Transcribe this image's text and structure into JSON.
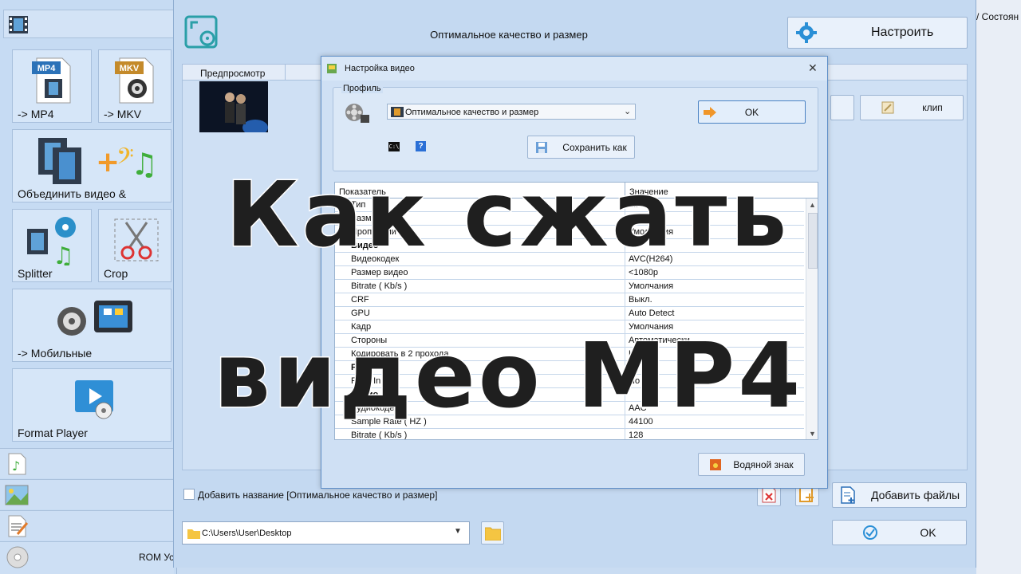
{
  "sidebar": {
    "tiles": [
      {
        "label": "-> MP4",
        "badge": "MP4"
      },
      {
        "label": "-> MKV",
        "badge": "MKV"
      },
      {
        "label": "Объединить видео &"
      },
      {
        "label": "Splitter"
      },
      {
        "label": "Crop"
      },
      {
        "label": "-> Мобильные"
      },
      {
        "label": "Format Player"
      }
    ],
    "bottom_text": "ROM Устройство\\DVD\\CD\\ISO"
  },
  "main": {
    "header_title": "Оптимальное качество и размер",
    "configure_label": "Настроить",
    "preview_header": "Предпросмотр",
    "clip_label": "клип",
    "add_name_label": "Добавить название [Оптимальное качество и размер]",
    "add_files_label": "Добавить файлы",
    "path_value": "C:\\Users\\User\\Desktop",
    "ok_label": "OK",
    "right_header": "/ Состоян"
  },
  "dialog": {
    "title": "Настройка видео",
    "profile_label": "Профиль",
    "profile_value": "Оптимальное качество и размер",
    "ok_label": "OK",
    "save_as_label": "Сохранить как",
    "help_glyph": "?",
    "table": {
      "col1": "Показатель",
      "col2": "Значение",
      "rows": [
        {
          "name": "Тип",
          "value": "MP4"
        },
        {
          "name": "Размер",
          "value": "Выкл."
        },
        {
          "name": "Пропорции",
          "value": "Умолчания"
        },
        {
          "name": "Видео",
          "value": ""
        },
        {
          "name": "Видеокодек",
          "value": "AVC(H264)"
        },
        {
          "name": "Размер видео",
          "value": "<1080p"
        },
        {
          "name": "Bitrate ( Kb/s )",
          "value": "Умолчания"
        },
        {
          "name": "CRF",
          "value": "Выкл."
        },
        {
          "name": "GPU",
          "value": "Auto Detect"
        },
        {
          "name": "Кадр",
          "value": "Умолчания"
        },
        {
          "name": "Стороны",
          "value": "Автоматически"
        },
        {
          "name": "Кодировать в 2 прохода",
          "value": "Нет"
        },
        {
          "name": "Fast Start",
          "value": ""
        },
        {
          "name": "Fade In",
          "value": "No"
        },
        {
          "name": "Аудио",
          "value": ""
        },
        {
          "name": "Аудиокодек",
          "value": "AAC"
        },
        {
          "name": "Sample Rate ( HZ )",
          "value": "44100"
        },
        {
          "name": "Bitrate ( Kb/s )",
          "value": "128"
        }
      ]
    },
    "watermark_label": "Водяной знак"
  },
  "overlay": {
    "line1": "Как сжать",
    "line2": "видео MP4"
  },
  "colors": {
    "window_bg": "#c4d9f1",
    "dialog_border": "#5f8fc8",
    "overlay_text": "#1f1f1f"
  }
}
